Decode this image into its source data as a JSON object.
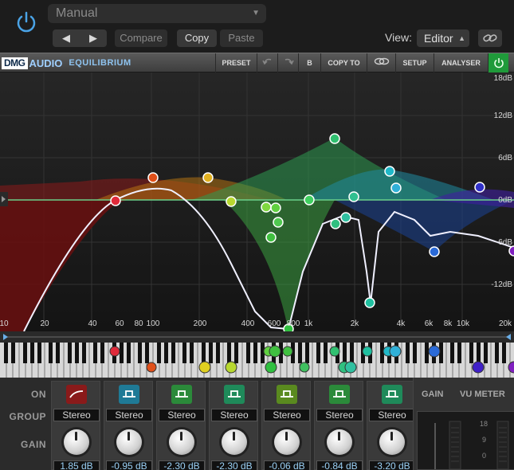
{
  "host": {
    "preset": "Manual",
    "prev": "◀",
    "next": "▶",
    "compare": "Compare",
    "copy": "Copy",
    "paste": "Paste",
    "view_label": "View:",
    "view_value": "Editor"
  },
  "plugin": {
    "brand_dmg": "DMG",
    "brand_audio": "AUDIO",
    "brand_name": "EQUILIBRIUM",
    "toolbar": {
      "preset": "PRESET",
      "b": "B",
      "copy_to": "COPY TO",
      "setup": "SETUP",
      "analyser": "ANALYSER"
    }
  },
  "graph": {
    "db_labels": [
      "18dB",
      "12dB",
      "6dB",
      "0dB",
      "-6dB",
      "-12dB"
    ],
    "freq_labels": [
      "10",
      "20",
      "40",
      "60",
      "80",
      "100",
      "200",
      "400",
      "600",
      "800",
      "1k",
      "2k",
      "4k",
      "6k",
      "8k",
      "10k",
      "20k"
    ]
  },
  "panel": {
    "labels": {
      "on": "ON",
      "group": "GROUP",
      "gain": "GAIN"
    },
    "bands": [
      {
        "group": "Stereo",
        "gain": "1.85 dB",
        "color": "#8a1a1a"
      },
      {
        "group": "Stereo",
        "gain": "-0.95 dB",
        "color": "#1f7a96"
      },
      {
        "group": "Stereo",
        "gain": "-2.30 dB",
        "color": "#2b8a3a"
      },
      {
        "group": "Stereo",
        "gain": "-2.30 dB",
        "color": "#1f8a5a"
      },
      {
        "group": "Stereo",
        "gain": "-0.06 dB",
        "color": "#5a8a1f"
      },
      {
        "group": "Stereo",
        "gain": "-0.84 dB",
        "color": "#2b8a3a"
      },
      {
        "group": "Stereo",
        "gain": "-3.20 dB",
        "color": "#1f8a5a"
      }
    ],
    "meter": {
      "gain_label": "GAIN",
      "vu_label": "VU METER",
      "scale": [
        "18",
        "9",
        "0"
      ]
    }
  },
  "colors": {
    "accent_blue": "#9fcfff",
    "power_green": "#1f9a3a",
    "host_power_blue": "#4aa3e6"
  }
}
